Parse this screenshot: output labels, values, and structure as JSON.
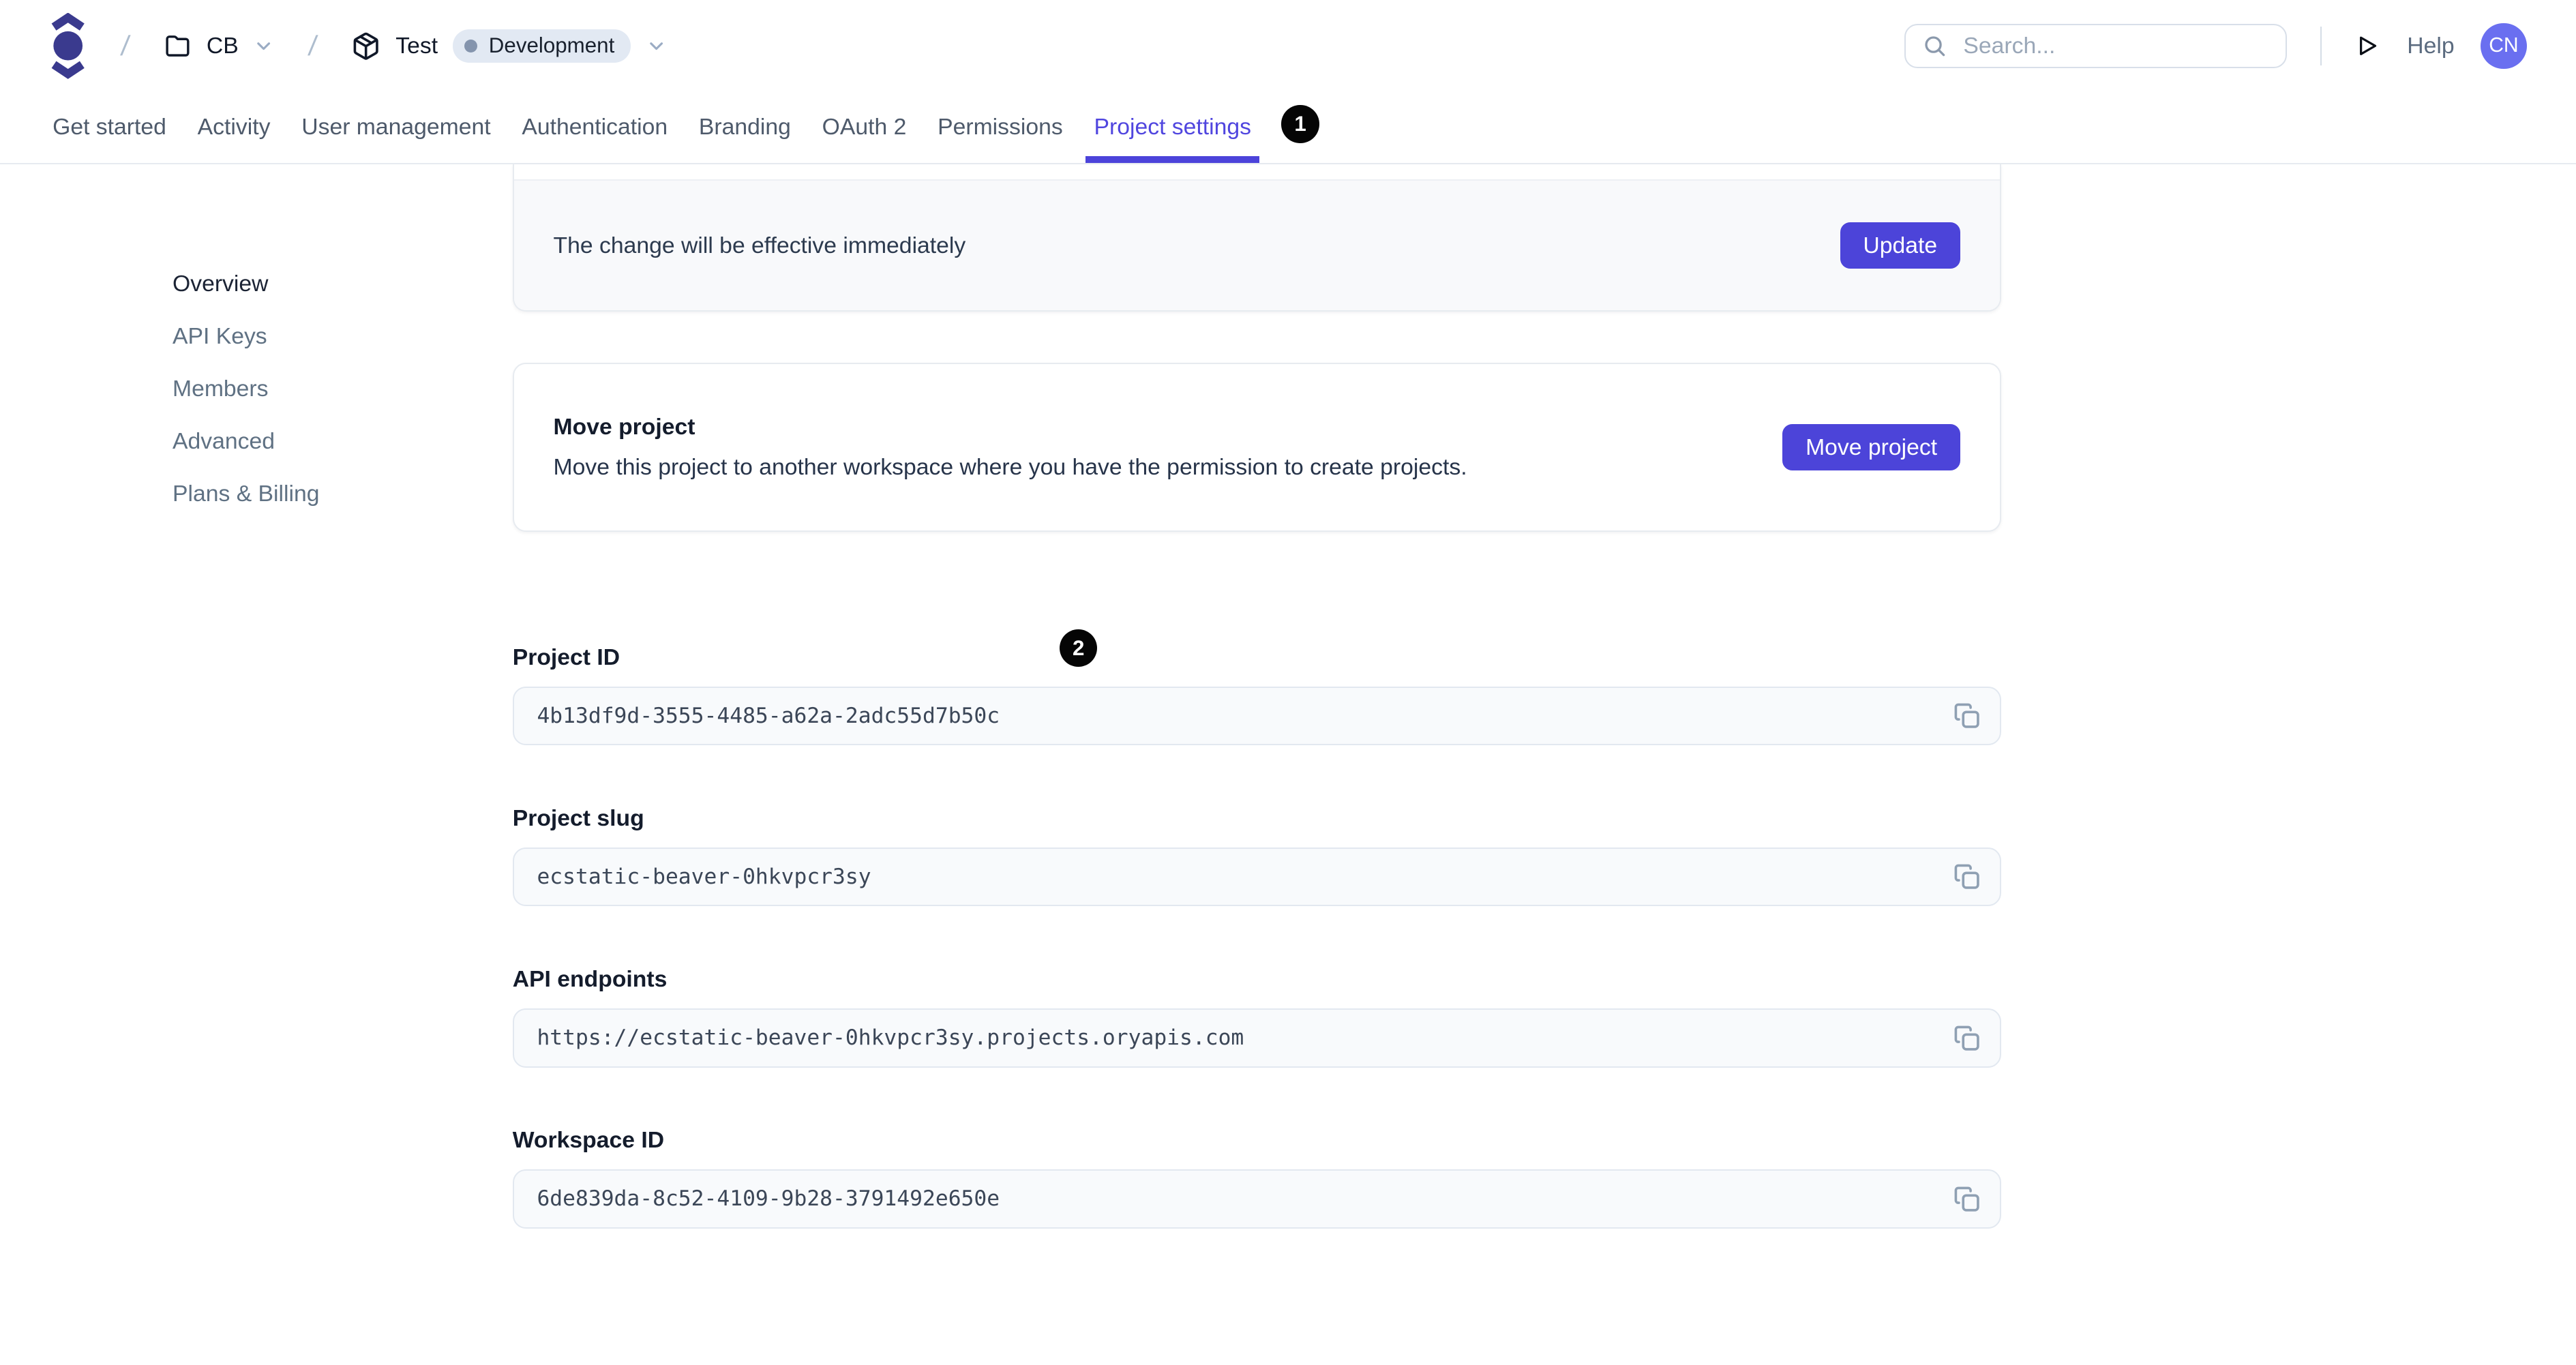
{
  "header": {
    "breadcrumb": {
      "separator": "/",
      "workspace": "CB",
      "project": "Test",
      "environment": "Development"
    },
    "search": {
      "placeholder": "Search..."
    },
    "help_label": "Help",
    "avatar_initials": "CN"
  },
  "tabs": {
    "items": [
      "Get started",
      "Activity",
      "User management",
      "Authentication",
      "Branding",
      "OAuth 2",
      "Permissions",
      "Project settings"
    ],
    "active": "Project settings"
  },
  "annotations": {
    "marker1": "1",
    "marker2": "2"
  },
  "sidebar": {
    "items": [
      "Overview",
      "API Keys",
      "Members",
      "Advanced",
      "Plans & Billing"
    ],
    "active": "Overview"
  },
  "update_card": {
    "note": "The change will be effective immediately",
    "button": "Update"
  },
  "move_card": {
    "title": "Move project",
    "description": "Move this project to another workspace where you have the permission to create projects.",
    "button": "Move project"
  },
  "fields": [
    {
      "label": "Project ID",
      "value": "4b13df9d-3555-4485-a62a-2adc55d7b50c"
    },
    {
      "label": "Project slug",
      "value": "ecstatic-beaver-0hkvpcr3sy"
    },
    {
      "label": "API endpoints",
      "value": "https://ecstatic-beaver-0hkvpcr3sy.projects.oryapis.com"
    },
    {
      "label": "Workspace ID",
      "value": "6de839da-8c52-4109-9b28-3791492e650e"
    }
  ],
  "colors": {
    "accent": "#4C44D9",
    "active_tab": "#5046DF",
    "logo": "#3A3A8E",
    "avatar_bg": "#6A6FF0",
    "env_badge_bg": "#E2E9F3",
    "env_badge_dot": "#8494AD",
    "marker_bg": "#050505",
    "field_bg": "#F8FAFC",
    "field_border": "#E2E8F0",
    "card_footer_bg": "#F8F9FB",
    "tab_inactive": "#4E5A6B",
    "sidebar_inactive": "#5F7183"
  }
}
